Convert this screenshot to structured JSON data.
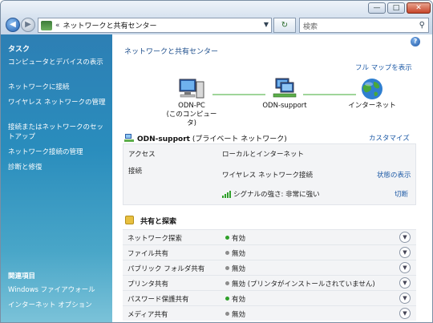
{
  "window": {
    "minimize": "—",
    "maximize": "□",
    "close": "✕",
    "address_path": "ネットワークと共有センター",
    "address_prefix": "«",
    "search_placeholder": "検索"
  },
  "sidebar": {
    "heading": "タスク",
    "tasks": [
      "コンピュータとデバイスの表示",
      "ネットワークに接続",
      "ワイヤレス ネットワークの管理",
      "接続またはネットワークのセットアップ",
      "ネットワーク接続の管理",
      "診断と修復"
    ],
    "related_heading": "関連項目",
    "related": [
      "Windows ファイアウォール",
      "インターネット オプション"
    ]
  },
  "main": {
    "title": "ネットワークと共有センター",
    "full_map": "フル マップを表示",
    "nodes": {
      "pc_name": "ODN-PC",
      "pc_sub": "(このコンピュータ)",
      "network": "ODN-support",
      "internet": "インターネット"
    },
    "network": {
      "name": "ODN-support",
      "type": "(プライベート ネットワーク)",
      "customize": "カスタマイズ",
      "access_label": "アクセス",
      "access_value": "ローカルとインターネット",
      "connection_label": "接続",
      "connection_value": "ワイヤレス ネットワーク接続",
      "view_status": "状態の表示",
      "signal": "シグナルの強さ: 非常に強い",
      "disconnect": "切断"
    },
    "sharing": {
      "heading": "共有と探索",
      "rows": [
        {
          "label": "ネットワーク探索",
          "value": "有効",
          "on": true
        },
        {
          "label": "ファイル共有",
          "value": "無効",
          "on": false
        },
        {
          "label": "パブリック フォルダ共有",
          "value": "無効",
          "on": false
        },
        {
          "label": "プリンタ共有",
          "value": "無効 (プリンタがインストールされていません)",
          "on": false
        },
        {
          "label": "パスワード保護共有",
          "value": "有効",
          "on": true
        },
        {
          "label": "メディア共有",
          "value": "無効",
          "on": false
        }
      ]
    }
  },
  "colors": {
    "on": "#2fa02a",
    "off": "#8c8c8c",
    "link": "#1d5aa6"
  }
}
